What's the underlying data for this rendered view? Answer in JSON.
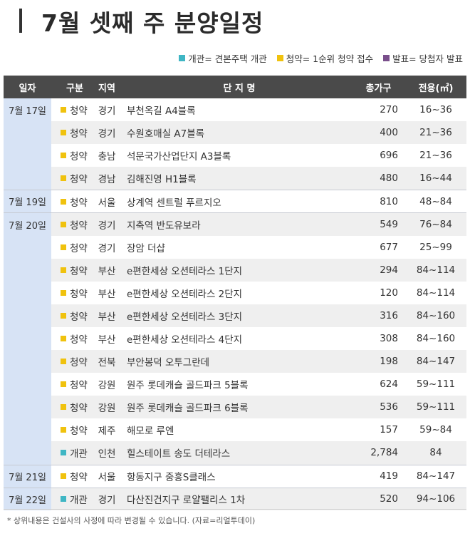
{
  "title": "7월 셋째 주 분양일정",
  "legend": [
    {
      "label": "개관= 견본주택 개관",
      "color": "#3fb6c4"
    },
    {
      "label": "청약= 1순위 청약 접수",
      "color": "#f0c20e"
    },
    {
      "label": "발표= 당첨자 발표",
      "color": "#7a4f8c"
    }
  ],
  "headers": {
    "date": "일자",
    "type": "구분",
    "region": "지역",
    "name": "단 지 명",
    "units": "총가구",
    "area": "전용(㎡)"
  },
  "rows": [
    {
      "date": "7월 17일",
      "type": "청약",
      "region": "경기",
      "name": "부천옥길 A4블록",
      "units": "270",
      "area": "16~36"
    },
    {
      "date": "",
      "type": "청약",
      "region": "경기",
      "name": "수원호매실 A7블록",
      "units": "400",
      "area": "21~36"
    },
    {
      "date": "",
      "type": "청약",
      "region": "충남",
      "name": "석문국가산업단지 A3블록",
      "units": "696",
      "area": "21~36"
    },
    {
      "date": "",
      "type": "청약",
      "region": "경남",
      "name": "김해진영 H1블록",
      "units": "480",
      "area": "16~44"
    },
    {
      "date": "7월 19일",
      "type": "청약",
      "region": "서울",
      "name": "상계역 센트럴 푸르지오",
      "units": "810",
      "area": "48~84"
    },
    {
      "date": "7월 20일",
      "type": "청약",
      "region": "경기",
      "name": "지축역 반도유보라",
      "units": "549",
      "area": "76~84"
    },
    {
      "date": "",
      "type": "청약",
      "region": "경기",
      "name": "장암 더샵",
      "units": "677",
      "area": "25~99"
    },
    {
      "date": "",
      "type": "청약",
      "region": "부산",
      "name": "e편한세상 오션테라스 1단지",
      "units": "294",
      "area": "84~114"
    },
    {
      "date": "",
      "type": "청약",
      "region": "부산",
      "name": "e편한세상 오션테라스 2단지",
      "units": "120",
      "area": "84~114"
    },
    {
      "date": "",
      "type": "청약",
      "region": "부산",
      "name": "e편한세상 오션테라스 3단지",
      "units": "316",
      "area": "84~160"
    },
    {
      "date": "",
      "type": "청약",
      "region": "부산",
      "name": "e편한세상 오션테라스 4단지",
      "units": "308",
      "area": "84~160"
    },
    {
      "date": "",
      "type": "청약",
      "region": "전북",
      "name": "부안봉덕 오투그란데",
      "units": "198",
      "area": "84~147"
    },
    {
      "date": "",
      "type": "청약",
      "region": "강원",
      "name": "원주 롯데캐슬 골드파크 5블록",
      "units": "624",
      "area": "59~111"
    },
    {
      "date": "",
      "type": "청약",
      "region": "강원",
      "name": "원주 롯데캐슬 골드파크 6블록",
      "units": "536",
      "area": "59~111"
    },
    {
      "date": "",
      "type": "청약",
      "region": "제주",
      "name": "해모로 루엔",
      "units": "157",
      "area": "59~84"
    },
    {
      "date": "",
      "type": "개관",
      "region": "인천",
      "name": "힐스테이트 송도 더테라스",
      "units": "2,784",
      "area": "84"
    },
    {
      "date": "7월 21일",
      "type": "청약",
      "region": "서울",
      "name": "항동지구 중흥S클래스",
      "units": "419",
      "area": "84~147"
    },
    {
      "date": "7월 22일",
      "type": "개관",
      "region": "경기",
      "name": "다산진건지구 로얄팰리스 1차",
      "units": "520",
      "area": "94~106"
    }
  ],
  "footnote": "* 상위내용은 건설사의 사정에 따라 변경될 수 있습니다. (자료=리얼투데이)",
  "colors": {
    "청약": "#f0c20e",
    "개관": "#3fb6c4",
    "발표": "#7a4f8c",
    "header_bg": "#4a4a4a",
    "date_bg": "#d7e3f5"
  }
}
